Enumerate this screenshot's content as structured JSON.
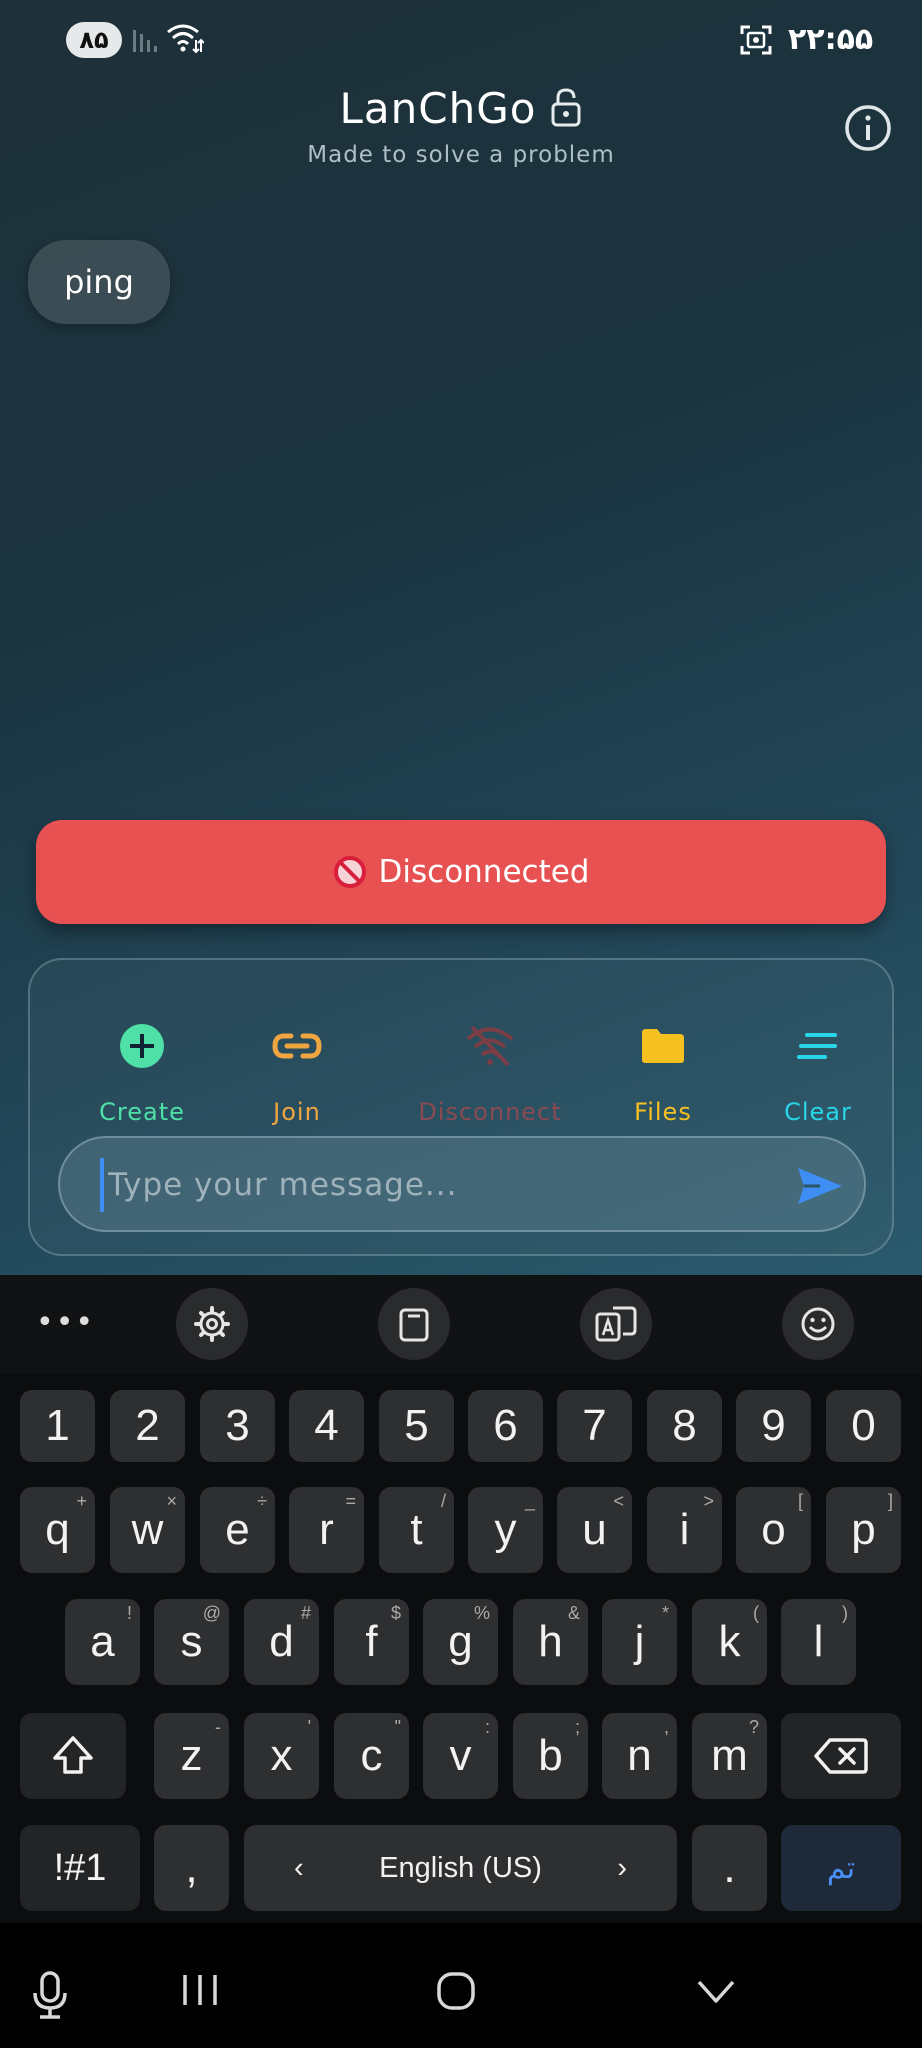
{
  "status_bar": {
    "battery": "۸۵",
    "clock": "۲۲:۵۵"
  },
  "header": {
    "title": "LanChGo",
    "subtitle": "Made to solve a problem"
  },
  "messages": [
    {
      "text": "ping"
    }
  ],
  "banner": {
    "text": "Disconnected",
    "color": "#e85152"
  },
  "actions": [
    {
      "label": "Create",
      "color": "#4fe0a8"
    },
    {
      "label": "Join",
      "color": "#f0a640"
    },
    {
      "label": "Disconnect",
      "color": "#8a4a52"
    },
    {
      "label": "Files",
      "color": "#f5c020"
    },
    {
      "label": "Clear",
      "color": "#29d6e8"
    }
  ],
  "composer": {
    "placeholder": "Type your message..."
  },
  "keyboard": {
    "number_row": [
      "1",
      "2",
      "3",
      "4",
      "5",
      "6",
      "7",
      "8",
      "9",
      "0"
    ],
    "row1": [
      {
        "k": "q",
        "s": "+"
      },
      {
        "k": "w",
        "s": "×"
      },
      {
        "k": "e",
        "s": "÷"
      },
      {
        "k": "r",
        "s": "="
      },
      {
        "k": "t",
        "s": "/"
      },
      {
        "k": "y",
        "s": "_"
      },
      {
        "k": "u",
        "s": "<"
      },
      {
        "k": "i",
        "s": ">"
      },
      {
        "k": "o",
        "s": "["
      },
      {
        "k": "p",
        "s": "]"
      }
    ],
    "row2": [
      {
        "k": "a",
        "s": "!"
      },
      {
        "k": "s",
        "s": "@"
      },
      {
        "k": "d",
        "s": "#"
      },
      {
        "k": "f",
        "s": "$"
      },
      {
        "k": "g",
        "s": "%"
      },
      {
        "k": "h",
        "s": "&"
      },
      {
        "k": "j",
        "s": "*"
      },
      {
        "k": "k",
        "s": "("
      },
      {
        "k": "l",
        "s": ")"
      }
    ],
    "row3": [
      {
        "k": "z",
        "s": "-"
      },
      {
        "k": "x",
        "s": "'"
      },
      {
        "k": "c",
        "s": "\""
      },
      {
        "k": "v",
        "s": ":"
      },
      {
        "k": "b",
        "s": ";"
      },
      {
        "k": "n",
        "s": ","
      },
      {
        "k": "m",
        "s": "?"
      }
    ],
    "symbols_key": "!#1",
    "comma_key": ",",
    "space_label": "English (US)",
    "period_key": ".",
    "done_key": "تم"
  }
}
